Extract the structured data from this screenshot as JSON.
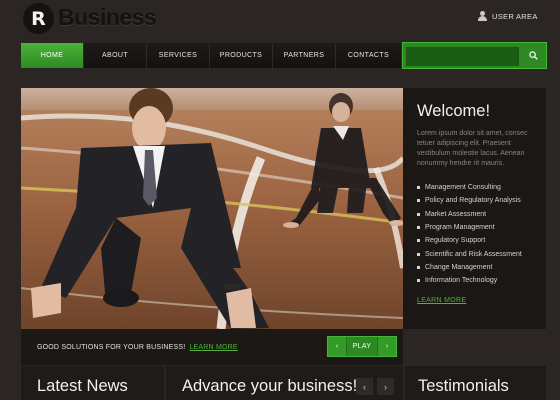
{
  "brand": {
    "logo_letter": "R",
    "name": "Business"
  },
  "header": {
    "user_area_label": "USER AREA"
  },
  "nav": {
    "items": [
      {
        "label": "HOME",
        "active": true
      },
      {
        "label": "ABOUT",
        "active": false
      },
      {
        "label": "SERVICES",
        "active": false
      },
      {
        "label": "PRODUCTS",
        "active": false
      },
      {
        "label": "PARTNERS",
        "active": false
      },
      {
        "label": "CONTACTS",
        "active": false
      }
    ]
  },
  "search": {
    "value": "",
    "placeholder": ""
  },
  "welcome": {
    "title": "Welcome!",
    "text": "Lorem ipsum dolor sit amet, consec tetuer adipiscing elit. Praesent vestibulum molestie lacus. Aenean nonummy hendre rit mauris.",
    "services": [
      "Management Consulting",
      "Policy and Regulatory Analysis",
      "Market Assessment",
      "Program Management",
      "Regulatory Support",
      "Scientific and Risk Assessment",
      "Change Management",
      "Information Technology"
    ],
    "learn_more": "LEARN MORE"
  },
  "strap": {
    "text": "GOOD SOLUTIONS FOR YOUR BUSINESS!",
    "learn_more": "LEARN MORE"
  },
  "slider": {
    "prev": "‹",
    "play": "PLAY",
    "next": "›"
  },
  "bottom": {
    "latest_news": "Latest News",
    "advance": "Advance your business!",
    "testimonials": "Testimonials",
    "prev_arrow": "‹",
    "next_arrow": "›"
  },
  "colors": {
    "accent_green": "#3a9f2c",
    "background": "#2b2623",
    "panel_dark": "#1a1715"
  },
  "icons": [
    "user-icon",
    "search-icon",
    "chevron-left-icon",
    "chevron-right-icon"
  ]
}
